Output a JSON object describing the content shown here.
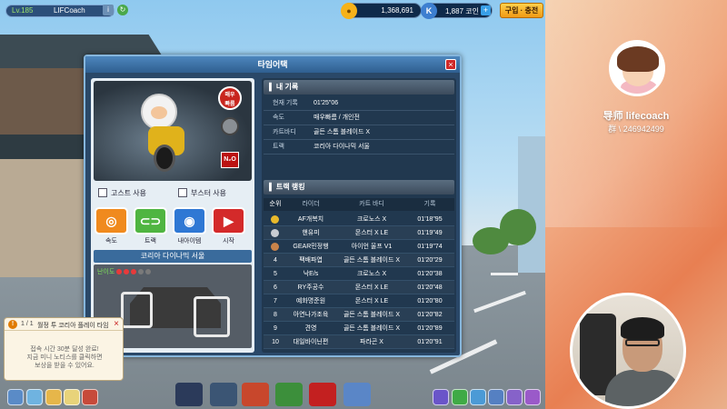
{
  "hud": {
    "level": "Lv.185",
    "player_name": "LIFCoach",
    "coins": "1,368,691",
    "coins_unit": "루찌",
    "kcash": "1,887",
    "kcash_unit": "코인",
    "buy_button": "구입 · 충전",
    "colors": {
      "accent": "#ffd04a",
      "coin": "#f6b21a",
      "kcash": "#3d7fd0"
    }
  },
  "dialog": {
    "title": "타임어택",
    "close": "×",
    "kart_badge": "매우\n빠름",
    "n2o_label": "N₂O",
    "checkbox_ghost": "고스트 사용",
    "checkbox_booster": "부스터 사용",
    "modes": [
      {
        "label": "속도",
        "icon": "speed-icon",
        "color": "#f08a1e"
      },
      {
        "label": "트랙",
        "icon": "track-icon",
        "color": "#4fb541"
      },
      {
        "label": "내아이템",
        "icon": "item-icon",
        "color": "#2f78d4"
      },
      {
        "label": "시작",
        "icon": "start-icon",
        "color": "#d42a2a"
      }
    ],
    "track_title": "코리아 다이나믹 서울",
    "difficulty_label": "난이도",
    "difficulty_dots": [
      true,
      true,
      true,
      false,
      false
    ],
    "my_record": {
      "header": "내 기록",
      "rows": [
        {
          "key": "현재 기록",
          "value": "01'25\"06"
        },
        {
          "key": "속도",
          "value": "매우빠름 / 개인전"
        },
        {
          "key": "카트바디",
          "value": "골든 스톰 블레이드 X"
        },
        {
          "key": "트랙",
          "value": "코리아 다이나믹 서울"
        }
      ]
    },
    "ranking": {
      "header": "트랙 랭킹",
      "columns": [
        "순위",
        "라이더",
        "카트 바디",
        "기록"
      ],
      "rows": [
        {
          "rank": "",
          "medal": "gold",
          "racer": "AF개복치",
          "kart": "크로노스 X",
          "time": "01'18\"95"
        },
        {
          "rank": "",
          "medal": "silver",
          "racer": "핸유미",
          "kart": "몬스터 X LE",
          "time": "01'19\"49"
        },
        {
          "rank": "",
          "medal": "bronze",
          "racer": "GEAR민정행",
          "kart": "아이언 울프 V1",
          "time": "01'19\"74"
        },
        {
          "rank": "4",
          "medal": "",
          "racer": "팩배파엽",
          "kart": "골든 스톰 블레이드 X",
          "time": "01'20\"29"
        },
        {
          "rank": "5",
          "medal": "",
          "racer": "낙E/s",
          "kart": "크로노스 X",
          "time": "01'20\"38"
        },
        {
          "rank": "6",
          "medal": "",
          "racer": "RY주공수",
          "kart": "몬스터 X LE",
          "time": "01'20\"48"
        },
        {
          "rank": "7",
          "medal": "",
          "racer": "예화명준원",
          "kart": "몬스터 X LE",
          "time": "01'20\"80"
        },
        {
          "rank": "8",
          "medal": "",
          "racer": "아연나가조육",
          "kart": "골든 스톰 블레이드 X",
          "time": "01'20\"82"
        },
        {
          "rank": "9",
          "medal": "",
          "racer": "견영",
          "kart": "골든 스톰 블레이드 X",
          "time": "01'20\"89"
        },
        {
          "rank": "10",
          "medal": "",
          "racer": "대일바이닌편",
          "kart": "파라곤 X",
          "time": "01'20\"91"
        }
      ]
    }
  },
  "notice": {
    "page": "1 / 1",
    "title": "월정 투 코리아 플레이 타임",
    "close": "×",
    "body": "접속 시간 30분 달성 완료!\n지금 미니 노티스를 클릭하면\n보상을 받을 수 있어요."
  },
  "overlay": {
    "streamer_name": "导师 lifecoach",
    "streamer_id": "群 \\ 246942499"
  }
}
